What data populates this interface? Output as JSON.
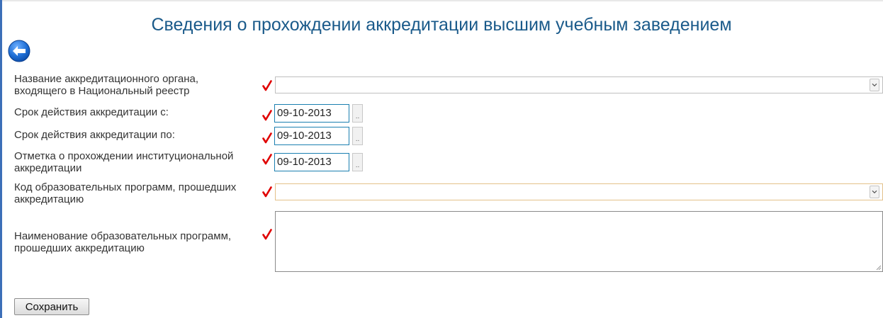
{
  "page": {
    "title": "Сведения о прохождении аккредитации высшим учебным заведением"
  },
  "icons": {
    "back": "back-arrow-icon",
    "required": "red-checkmark-icon"
  },
  "colors": {
    "title": "#1a5a8a",
    "required_check": "#e00000",
    "date_border": "#1b7fb0",
    "frame": "#3c6fb8"
  },
  "form": {
    "accreditation_body": {
      "label_line1": "Название аккредитационного органа,",
      "label_line2": "входящего в Национальный реестр",
      "value": ""
    },
    "valid_from": {
      "label": "Срок действия аккредитации с:",
      "value": "09-10-2013",
      "picker_label": ".."
    },
    "valid_to": {
      "label": "Срок действия аккредитации по:",
      "value": "09-10-2013",
      "picker_label": ".."
    },
    "institutional_mark": {
      "label_line1": "Отметка о прохождении институциональной",
      "label_line2": "аккредитации",
      "value": "09-10-2013",
      "picker_label": ".."
    },
    "program_code": {
      "label_line1": "Код образовательных программ, прошедших",
      "label_line2": "аккредитацию",
      "value": ""
    },
    "program_name": {
      "label_line1": "Наименование образовательных программ,",
      "label_line2": "прошедших аккредитацию",
      "value": ""
    }
  },
  "actions": {
    "save_label": "Сохранить"
  }
}
